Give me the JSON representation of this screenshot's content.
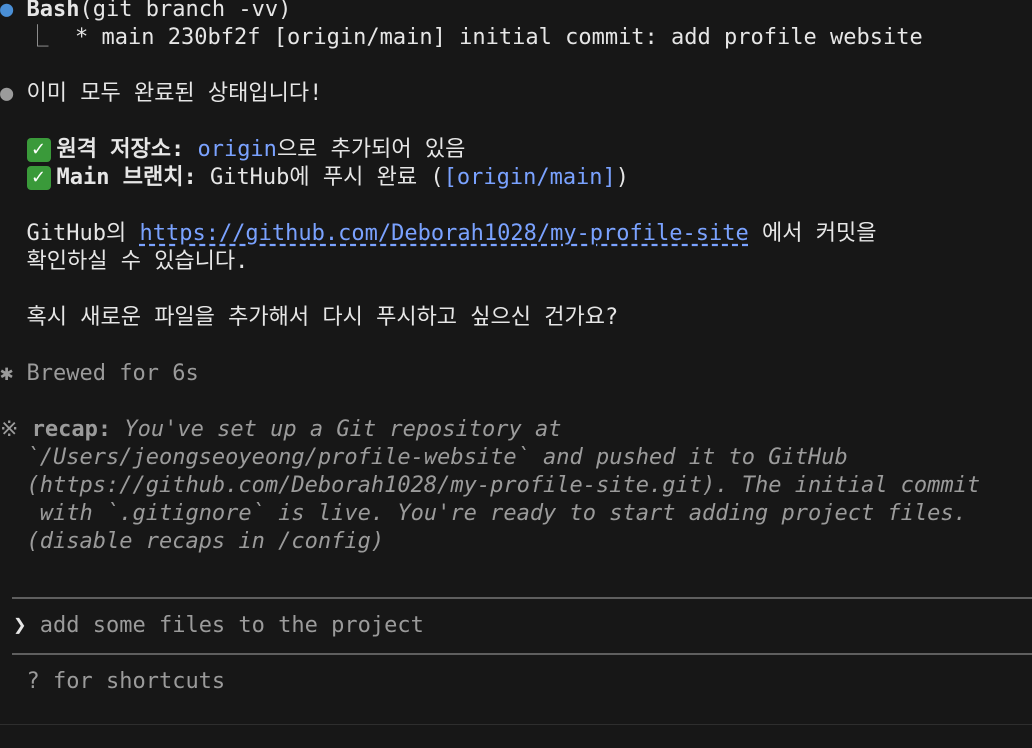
{
  "bash_block": {
    "tool": "Bash",
    "command": "(git branch -vv)",
    "tree_glyph": "⎿",
    "output": "* main 230bf2f [origin/main] initial commit: add profile website"
  },
  "message": {
    "headline": "이미 모두 완료된 상태입니다!",
    "check_items": [
      {
        "label": "원격 저장소:",
        "link": "origin",
        "suffix": "으로 추가되어 있음"
      },
      {
        "label": "Main 브랜치:",
        "text": " GitHub에 푸시 완료 (",
        "link": "[origin/main]",
        "suffix": ")"
      }
    ],
    "github_prefix": "GitHub의 ",
    "github_url": "https://github.com/Deborah1028/my-profile-site",
    "github_suffix": " 에서 커밋을",
    "github_line2": "확인하실 수 있습니다.",
    "question": "혹시 새로운 파일을 추가해서 다시 푸시하고 싶으신 건가요?"
  },
  "status": {
    "brewed": "Brewed for 6s"
  },
  "recap": {
    "label": "recap:",
    "line1": " You've set up a Git repository at",
    "line2": "`/Users/jeongseoyeong/profile-website` and pushed it to GitHub",
    "line3": "(https://github.com/Deborah1028/my-profile-site.git). The initial commit",
    "line4": " with `.gitignore` is live. You're ready to start adding project files.",
    "line5": "(disable recaps in /config)"
  },
  "input": {
    "prompt_symbol": "❯",
    "placeholder": "add some files to the project"
  },
  "footer": {
    "hint": "? for shortcuts"
  },
  "colors": {
    "background": "#171717",
    "text": "#e6e6e6",
    "link": "#7aa2ff",
    "dim": "#9b9b9b",
    "bash_bullet": "#4a8fd6",
    "check": "#3a9a3a"
  }
}
